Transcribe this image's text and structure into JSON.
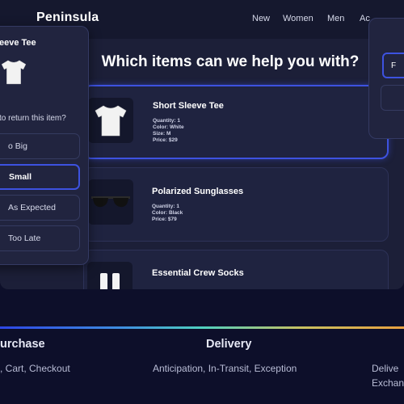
{
  "brand": "Peninsula",
  "nav_links": [
    "New",
    "Women",
    "Men",
    "Ac"
  ],
  "headline": "Which items can we help you with?",
  "products": [
    {
      "name": "Short Sleeve Tee",
      "quantity": "Quantity: 1",
      "color": "Color: White",
      "size": "Size: M",
      "price": "Price: $29",
      "thumb_icon": "tshirt-icon"
    },
    {
      "name": "Polarized Sunglasses",
      "quantity": "Quantity: 1",
      "color": "Color: Black",
      "price": "Price: $79",
      "thumb_icon": "sunglasses-icon"
    },
    {
      "name": "Essential Crew Socks",
      "thumb_icon": "socks-icon"
    }
  ],
  "return_panel": {
    "item_title": "eeve Tee",
    "question": "to return this item?",
    "reasons": [
      "o Big",
      "Small",
      "As Expected",
      "Too Late"
    ],
    "selected_reason": "Small"
  },
  "right_panel": {
    "button_label": "F"
  },
  "stages": [
    {
      "title": "urchase",
      "desc": ", Cart, Checkout"
    },
    {
      "title": "Delivery",
      "desc": "Anticipation, In-Transit, Exception"
    },
    {
      "title": "",
      "desc_lines": [
        "Delive",
        "Exchan"
      ]
    }
  ],
  "colors": {
    "accent": "#3d52e0",
    "background": "#0d0f2a",
    "panel": "#1c1f38"
  }
}
